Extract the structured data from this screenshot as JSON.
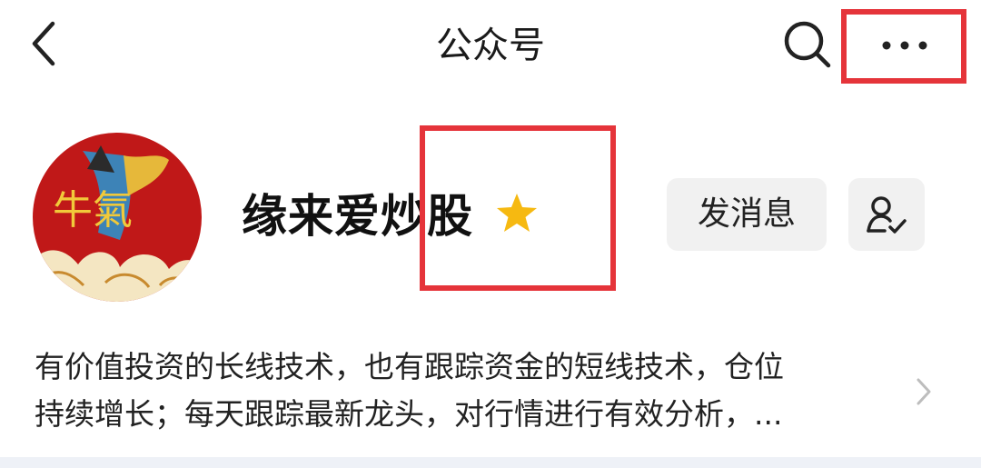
{
  "header": {
    "back_icon": "chevron-left-icon",
    "title": "公众号",
    "search_icon": "search-icon",
    "more_icon": "more-horizontal-icon"
  },
  "profile": {
    "avatar_icon": "avatar",
    "avatar_text": "牛氣",
    "name": "缘来爱炒股",
    "star_icon": "star-icon",
    "star_color": "#f6b911",
    "send_message_label": "发消息",
    "follow_icon": "user-check-icon"
  },
  "description": {
    "line1": "有价值投资的长线技术，也有跟踪资金的短线技术，仓位",
    "line2": "持续增长；每天跟踪最新龙头，对行情进行有效分析，...",
    "chevron_icon": "chevron-right-icon"
  },
  "colors": {
    "highlight": "#e5343a",
    "avatar_bg": "#c01818",
    "button_bg": "#f1f1f1"
  }
}
